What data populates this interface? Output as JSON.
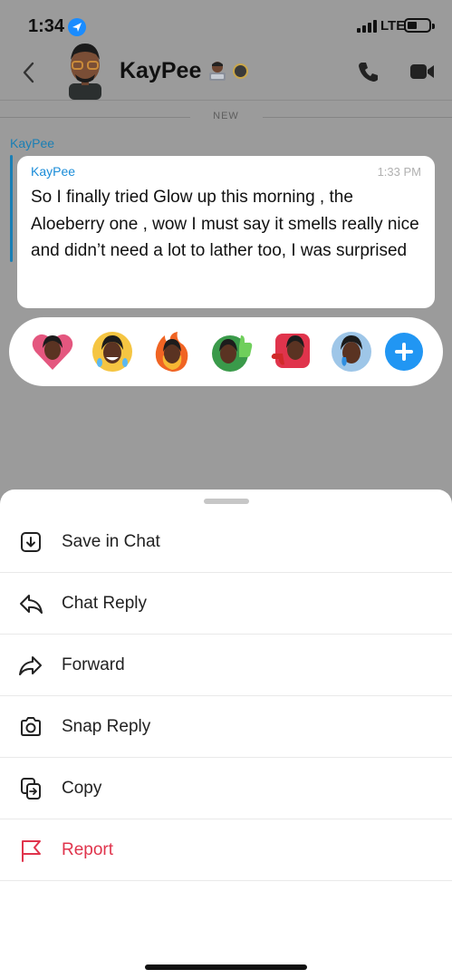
{
  "status_bar": {
    "time": "1:34",
    "network": "LTE"
  },
  "header": {
    "contact_name": "KayPee"
  },
  "chat": {
    "new_label": "NEW",
    "sender": "KayPee",
    "message": {
      "name": "KayPee",
      "time": "1:33 PM",
      "text": "So I finally tried Glow up this morning , the Aloeberry one , wow I must say it smells really nice and didn’t need a lot to lather too, I was surprised"
    }
  },
  "reactions": [
    "heart-bitmoji",
    "laughing-tears-bitmoji",
    "fire-bitmoji",
    "thumbs-up-bitmoji",
    "thumbs-down-bitmoji",
    "crying-bitmoji"
  ],
  "menu": {
    "items": [
      {
        "label": "Save in Chat",
        "icon": "save-icon"
      },
      {
        "label": "Chat Reply",
        "icon": "reply-icon"
      },
      {
        "label": "Forward",
        "icon": "forward-icon"
      },
      {
        "label": "Snap Reply",
        "icon": "camera-icon"
      },
      {
        "label": "Copy",
        "icon": "copy-icon"
      },
      {
        "label": "Report",
        "icon": "flag-icon"
      }
    ]
  },
  "colors": {
    "accent_blue": "#1a7fb5",
    "plus_blue": "#2196f3",
    "report_red": "#e0344c",
    "dim_overlay": "#9b9b9b"
  }
}
